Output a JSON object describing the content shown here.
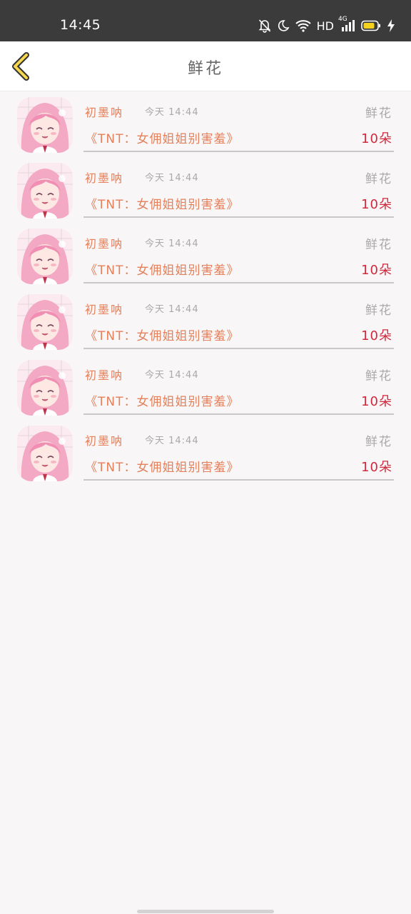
{
  "status_bar": {
    "time": "14:45",
    "hd": "HD",
    "network": "4G",
    "icons": [
      "mute-bell-icon",
      "moon-icon",
      "wifi-icon",
      "signal-icon",
      "battery-icon",
      "charging-icon"
    ]
  },
  "header": {
    "title": "鲜花",
    "back_icon": "chevron-left-icon"
  },
  "colors": {
    "accent_orange": "#e5805a",
    "amount_red": "#d2283d",
    "muted_gray": "#a9a9a9",
    "back_arrow_yellow": "#f5d64e"
  },
  "records": [
    {
      "user": "初墨呐",
      "time": "今天 14:44",
      "gift": "鲜花",
      "book": "《TNT：女佣姐姐别害羞》",
      "amount": "10朵"
    },
    {
      "user": "初墨呐",
      "time": "今天 14:44",
      "gift": "鲜花",
      "book": "《TNT：女佣姐姐别害羞》",
      "amount": "10朵"
    },
    {
      "user": "初墨呐",
      "time": "今天 14:44",
      "gift": "鲜花",
      "book": "《TNT：女佣姐姐别害羞》",
      "amount": "10朵"
    },
    {
      "user": "初墨呐",
      "time": "今天 14:44",
      "gift": "鲜花",
      "book": "《TNT：女佣姐姐别害羞》",
      "amount": "10朵"
    },
    {
      "user": "初墨呐",
      "time": "今天 14:44",
      "gift": "鲜花",
      "book": "《TNT：女佣姐姐别害羞》",
      "amount": "10朵"
    },
    {
      "user": "初墨呐",
      "time": "今天 14:44",
      "gift": "鲜花",
      "book": "《TNT：女佣姐姐别害羞》",
      "amount": "10朵"
    }
  ]
}
